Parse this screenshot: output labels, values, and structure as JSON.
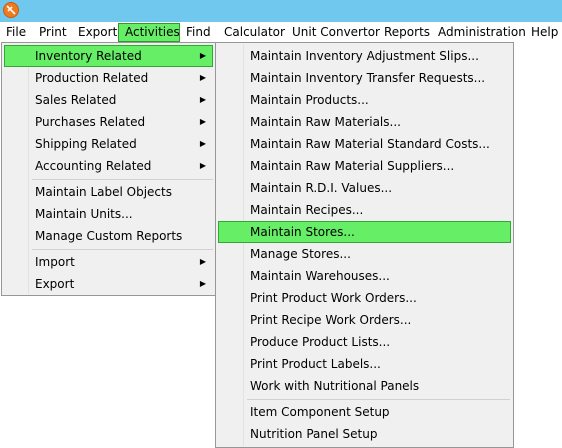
{
  "menubar": {
    "items": [
      "File",
      "Print",
      "Export",
      "Activities",
      "Find",
      "Calculator",
      "Unit Convertor",
      "Reports",
      "Administration",
      "Help"
    ]
  },
  "activities_menu": {
    "items": [
      {
        "label": "Inventory Related",
        "submenu": true,
        "highlighted": true
      },
      {
        "label": "Production Related",
        "submenu": true
      },
      {
        "label": "Sales Related",
        "submenu": true
      },
      {
        "label": "Purchases Related",
        "submenu": true
      },
      {
        "label": "Shipping Related",
        "submenu": true
      },
      {
        "label": "Accounting Related",
        "submenu": true
      },
      {
        "label": "Maintain Label Objects"
      },
      {
        "label": "Maintain Units..."
      },
      {
        "label": "Manage Custom Reports"
      },
      {
        "label": "Import",
        "submenu": true
      },
      {
        "label": "Export",
        "submenu": true
      }
    ],
    "arrow_glyph": "▶"
  },
  "inventory_submenu": {
    "items": [
      {
        "label": "Maintain Inventory Adjustment Slips..."
      },
      {
        "label": "Maintain Inventory Transfer Requests..."
      },
      {
        "label": "Maintain Products..."
      },
      {
        "label": "Maintain Raw Materials..."
      },
      {
        "label": "Maintain Raw Material Standard Costs..."
      },
      {
        "label": "Maintain Raw Material Suppliers..."
      },
      {
        "label": "Maintain R.D.I. Values..."
      },
      {
        "label": "Maintain Recipes..."
      },
      {
        "label": "Maintain Stores...",
        "highlighted": true
      },
      {
        "label": "Manage Stores..."
      },
      {
        "label": "Maintain Warehouses..."
      },
      {
        "label": "Print Product Work Orders..."
      },
      {
        "label": "Print Recipe Work Orders..."
      },
      {
        "label": "Produce Product Lists..."
      },
      {
        "label": "Print Product Labels..."
      },
      {
        "label": "Work with Nutritional Panels"
      },
      {
        "label": "Item Component Setup"
      },
      {
        "label": "Nutrition Panel Setup"
      }
    ]
  },
  "colors": {
    "titlebar": "#70c8ef",
    "highlight": "#66ee66",
    "menu_background": "#f0f0f0"
  }
}
